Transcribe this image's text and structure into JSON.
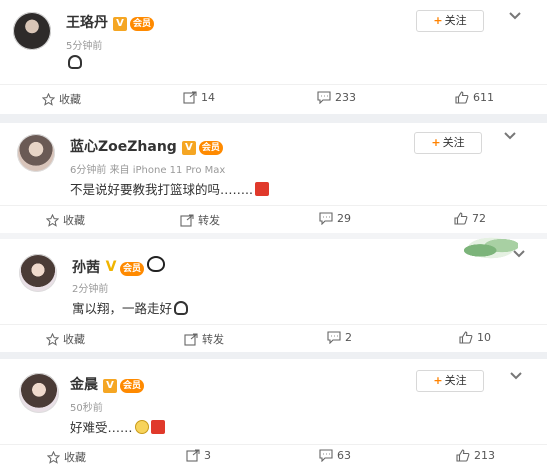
{
  "posts": [
    {
      "name": "王珞丹",
      "verified": "V",
      "time": "5分钟前",
      "source": "",
      "text": "",
      "follow": "关注",
      "actions": {
        "collect": "收藏",
        "repost": "14",
        "comment": "233",
        "like": "611"
      }
    },
    {
      "name": "蓝心ZoeZhang",
      "verified": "V",
      "time": "6分钟前",
      "source": "来自 iPhone 11 Pro Max",
      "text": "不是说好要教我打篮球的吗……..",
      "follow": "关注",
      "actions": {
        "collect": "收藏",
        "repost": "转发",
        "comment": "29",
        "like": "72"
      }
    },
    {
      "name": "孙茜",
      "verified": "V",
      "time": "2分钟前",
      "source": "",
      "text": "寓以翔，一路走好",
      "follow": "",
      "actions": {
        "collect": "收藏",
        "repost": "转发",
        "comment": "2",
        "like": "10"
      }
    },
    {
      "name": "金晨",
      "verified": "V",
      "time": "50秒前",
      "source": "",
      "text": "好难受……",
      "follow": "关注",
      "actions": {
        "collect": "收藏",
        "repost": "3",
        "comment": "63",
        "like": "213"
      }
    }
  ],
  "vip_label": "会员",
  "colors": {
    "accent": "#ff8200",
    "verified": "#f5a623",
    "separator": "#eef0f3"
  }
}
